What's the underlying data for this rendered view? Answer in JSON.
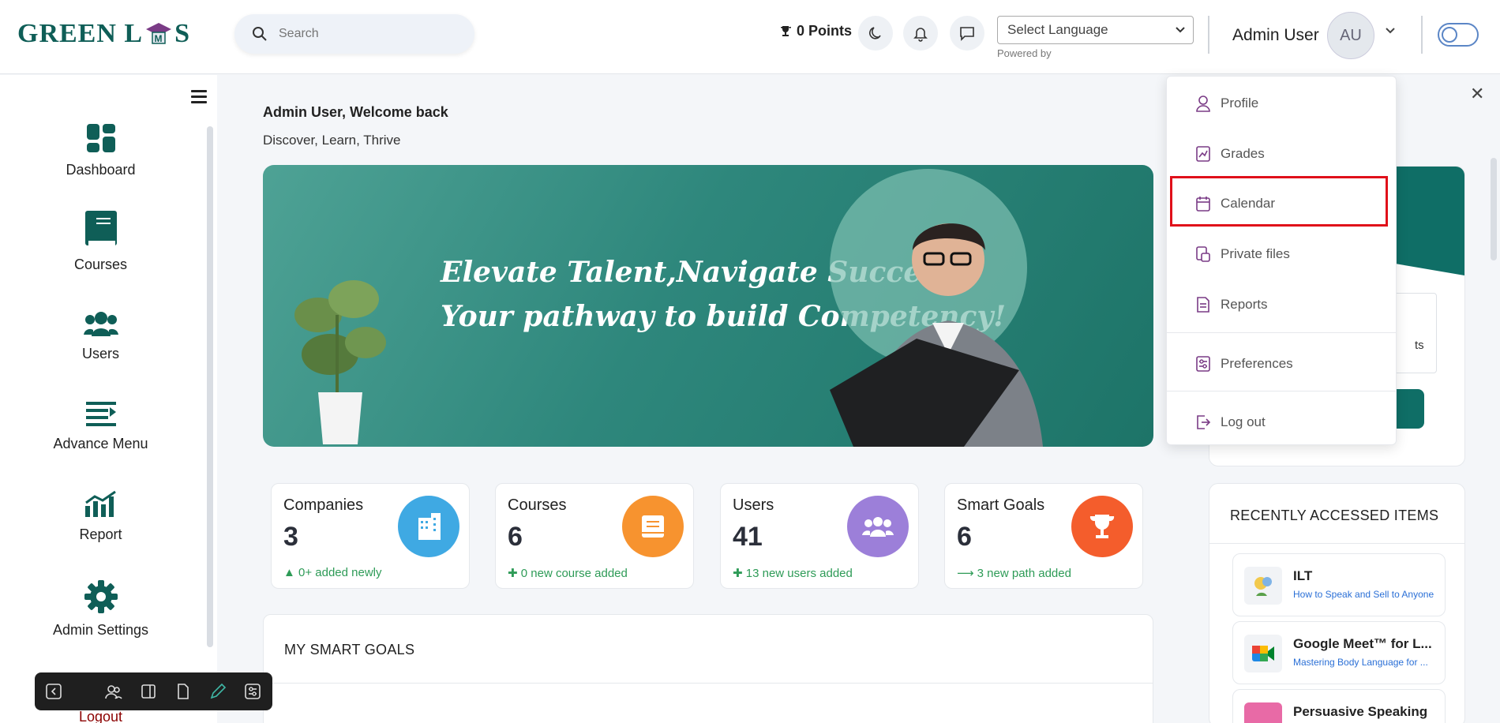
{
  "header": {
    "logo_text_left": "GREEN L",
    "logo_text_right": "S",
    "logo_cap_letter": "M",
    "search_placeholder": "Search",
    "points": "0 Points",
    "language_select": "Select Language",
    "powered_by": "Powered by",
    "user_name": "Admin User",
    "avatar_initials": "AU"
  },
  "sidebar": {
    "items": [
      {
        "label": "Dashboard",
        "icon": "dashboard-icon"
      },
      {
        "label": "Courses",
        "icon": "book-icon"
      },
      {
        "label": "Users",
        "icon": "users-icon"
      },
      {
        "label": "Advance Menu",
        "icon": "list-icon"
      },
      {
        "label": "Report",
        "icon": "chart-icon"
      },
      {
        "label": "Admin Settings",
        "icon": "gear-icon"
      }
    ],
    "logout": "Logout"
  },
  "main": {
    "welcome": "Admin User, Welcome back",
    "tagline": "Discover, Learn, Thrive",
    "banner_line1": "Elevate Talent,Navigate Success:",
    "banner_line2": "Your pathway to build Competency!",
    "stats": [
      {
        "title": "Companies",
        "value": "3",
        "sub": "0+ added newly",
        "color": "#3fa9e3"
      },
      {
        "title": "Courses",
        "value": "6",
        "sub": "0 new course added",
        "color": "#f7932f"
      },
      {
        "title": "Users",
        "value": "41",
        "sub": "13 new users added",
        "color": "#9c7fd9"
      },
      {
        "title": "Smart Goals",
        "value": "6",
        "sub": "3 new path added",
        "color": "#f45d2c"
      }
    ],
    "goals_title": "MY SMART GOALS"
  },
  "right": {
    "partial_text": "ts",
    "recent_title": "RECENTLY ACCESSED ITEMS",
    "recent": [
      {
        "title": "ILT",
        "subtitle": "How to Speak and Sell to Anyone"
      },
      {
        "title": "Google Meet™ for L...",
        "subtitle": "Mastering Body Language for ..."
      },
      {
        "title": "Persuasive Speaking",
        "subtitle": ""
      }
    ]
  },
  "dropdown": {
    "items": [
      {
        "label": "Profile",
        "icon": "user-icon"
      },
      {
        "label": "Grades",
        "icon": "grades-icon"
      },
      {
        "label": "Calendar",
        "icon": "calendar-icon"
      },
      {
        "label": "Private files",
        "icon": "files-icon"
      },
      {
        "label": "Reports",
        "icon": "report-icon"
      },
      {
        "label": "Preferences",
        "icon": "preferences-icon"
      },
      {
        "label": "Log out",
        "icon": "logout-icon"
      }
    ]
  },
  "colors": {
    "brand": "#0f5e57",
    "accent": "#0f6e66",
    "highlight": "#e0101a",
    "dropdown_icon": "#7a3b86"
  }
}
